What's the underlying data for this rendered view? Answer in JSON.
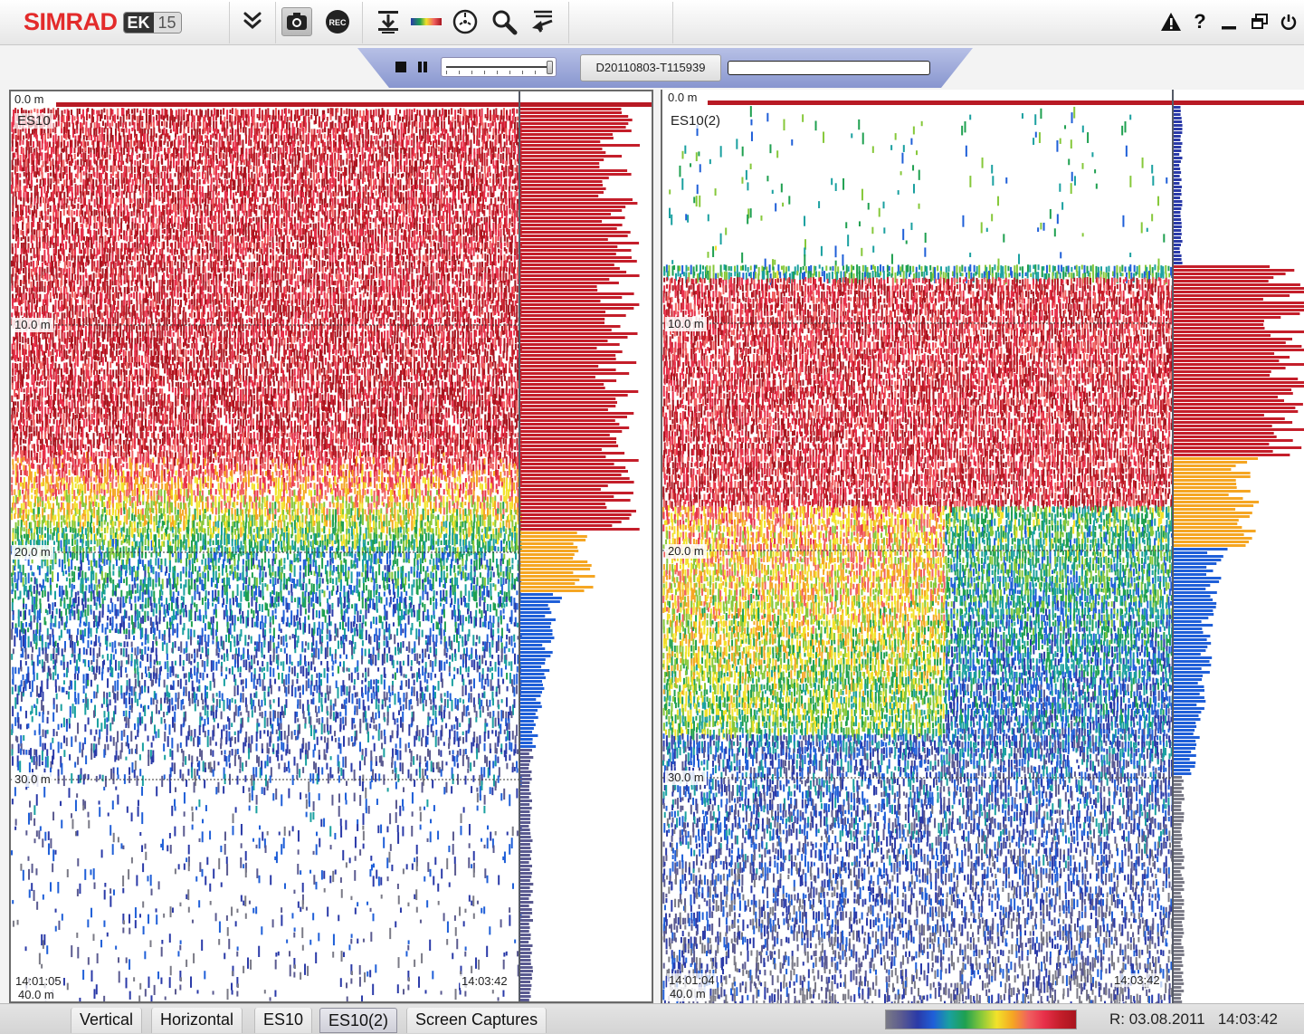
{
  "toolbar": {
    "logo_text": "SIMRAD",
    "logo_model_prefix": "EK",
    "logo_model_number": "15",
    "record_label": "REC",
    "icons": [
      "chevrons-down-icon",
      "camera-icon",
      "record-icon",
      "depth-range-icon",
      "color-scale-icon",
      "target-icon",
      "zoom-icon",
      "transmit-icon"
    ],
    "window_icons": [
      "warning-icon",
      "help-icon",
      "minimize-icon",
      "restore-icon",
      "power-icon"
    ],
    "help_label": "?",
    "minimize_label": "_"
  },
  "replay": {
    "file_name": "D20110803-T115939",
    "slider_position": 1.0,
    "progress": 0.0
  },
  "panels": [
    {
      "channel": "ES10",
      "depth_labels": [
        "0.0 m",
        "10.0 m",
        "20.0 m",
        "30.0 m",
        "40.0 m"
      ],
      "start_time": "14:01:05",
      "end_time": "14:03:42"
    },
    {
      "channel": "ES10(2)",
      "depth_labels": [
        "0.0 m",
        "10.0 m",
        "20.0 m",
        "30.0 m",
        "40.0 m"
      ],
      "start_time": "14:01:04",
      "end_time": "14:03:42"
    }
  ],
  "tabs": [
    {
      "label": "Vertical",
      "active": false
    },
    {
      "label": "Horizontal",
      "active": false
    },
    {
      "label": "ES10",
      "active": false
    },
    {
      "label": "ES10(2)",
      "active": true
    },
    {
      "label": "Screen Captures",
      "active": false
    }
  ],
  "color_scale": [
    "#7a7a86",
    "#5a5a90",
    "#2a3aa8",
    "#1f5fd8",
    "#1aa0a0",
    "#1fa050",
    "#86c83a",
    "#f2e22a",
    "#f5a623",
    "#f06060",
    "#e8304a",
    "#c41e2a",
    "#a8141e"
  ],
  "status": {
    "date": "R: 03.08.2011",
    "time": "14:03:42"
  }
}
